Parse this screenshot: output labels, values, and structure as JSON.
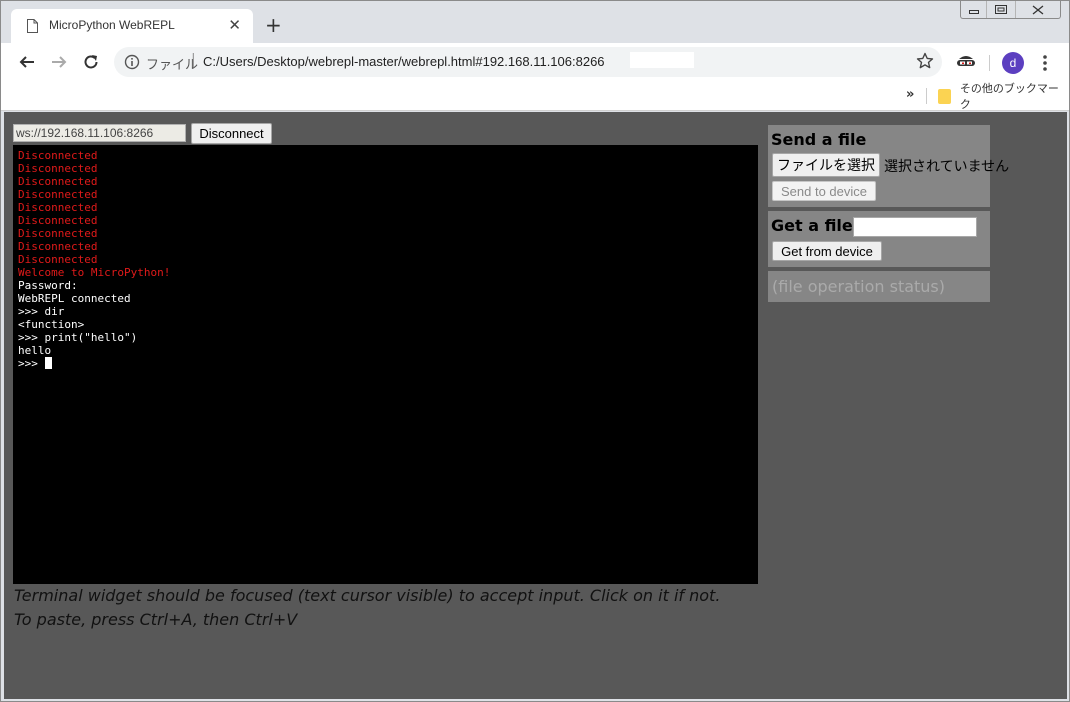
{
  "browser": {
    "tab_title": "MicroPython WebREPL",
    "tab_close_glyph": "✕",
    "new_tab_glyph": "+",
    "url_scheme_label": "ファイル",
    "url_separator": "|",
    "url": "C:/Users/Desktop/webrepl-master/webrepl.html#192.168.11.106:8266",
    "avatar_letter": "d",
    "bookmarks_overflow": "»",
    "bookmarks_folder": "その他のブックマーク",
    "icons": [
      "file-icon",
      "back-arrow-icon",
      "forward-arrow-icon",
      "reload-icon",
      "info-icon",
      "star-icon",
      "spy-extension-icon",
      "kebab-menu-icon",
      "folder-icon",
      "minimize-icon",
      "maximize-icon",
      "window-close-icon"
    ]
  },
  "connection": {
    "address": "ws://192.168.11.106:8266",
    "disconnect_label": "Disconnect"
  },
  "terminal": {
    "lines": [
      {
        "text": "Disconnected",
        "color": "#e01a1a"
      },
      {
        "text": "Disconnected",
        "color": "#e01a1a"
      },
      {
        "text": "Disconnected",
        "color": "#e01a1a"
      },
      {
        "text": "Disconnected",
        "color": "#e01a1a"
      },
      {
        "text": "Disconnected",
        "color": "#e01a1a"
      },
      {
        "text": "Disconnected",
        "color": "#e01a1a"
      },
      {
        "text": "Disconnected",
        "color": "#e01a1a"
      },
      {
        "text": "Disconnected",
        "color": "#e01a1a"
      },
      {
        "text": "Disconnected",
        "color": "#e01a1a"
      },
      {
        "text": "Welcome to MicroPython!",
        "color": "#e01a1a"
      },
      {
        "text": "Password:",
        "color": "#ffffff"
      },
      {
        "text": "WebREPL connected",
        "color": "#ffffff"
      },
      {
        "text": ">>> dir",
        "color": "#ffffff"
      },
      {
        "text": "<function>",
        "color": "#ffffff"
      },
      {
        "text": ">>> print(\"hello\")",
        "color": "#ffffff"
      },
      {
        "text": "hello",
        "color": "#ffffff"
      }
    ],
    "prompt": ">>> "
  },
  "hints": {
    "line1": "Terminal widget should be focused (text cursor visible) to accept input. Click on it if not.",
    "line2": "To paste, press Ctrl+A, then Ctrl+V"
  },
  "send_file": {
    "title": "Send a file",
    "choose_label": "ファイルを選択",
    "no_file_text": "選択されていません",
    "send_label": "Send to device"
  },
  "get_file": {
    "title": "Get a file",
    "input_value": "",
    "get_label": "Get from device"
  },
  "status": {
    "placeholder": "(file operation status)"
  },
  "colors": {
    "page_background": "#585858",
    "panel_background": "#868686",
    "terminal_background": "#000000",
    "terminal_error": "#e01a1a",
    "avatar": "#5c3fc0"
  }
}
